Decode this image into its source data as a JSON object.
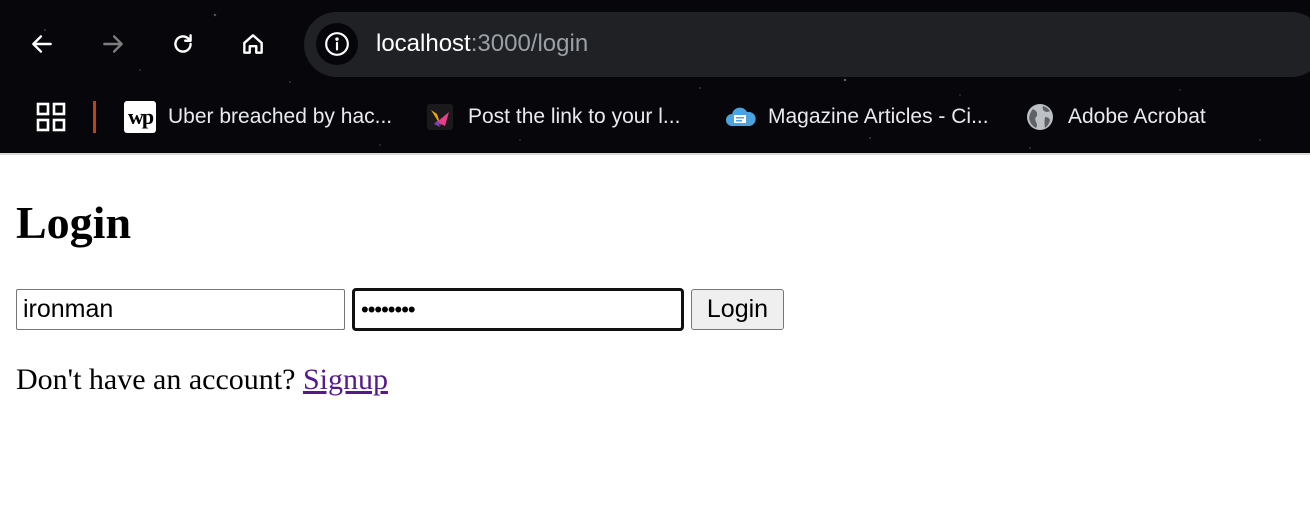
{
  "browser": {
    "url_host": "localhost",
    "url_path": ":3000/login",
    "bookmarks": [
      {
        "label": "Uber breached by hac...",
        "icon": "washington-post-icon"
      },
      {
        "label": "Post the link to your l...",
        "icon": "stack-logo-icon"
      },
      {
        "label": "Magazine Articles - Ci...",
        "icon": "cloud-doc-icon"
      },
      {
        "label": "Adobe Acrobat",
        "icon": "globe-icon"
      }
    ],
    "wp_favicon_text": "wp"
  },
  "page": {
    "title": "Login",
    "username_value": "ironman",
    "password_value": "password",
    "login_button_label": "Login",
    "signup_prompt": "Don't have an account? ",
    "signup_link_label": "Signup"
  },
  "colors": {
    "chrome_bg": "#07070b",
    "omnibox_bg": "#202124",
    "link_visited": "#551a8b",
    "bookmark_separator": "#c1440e"
  }
}
